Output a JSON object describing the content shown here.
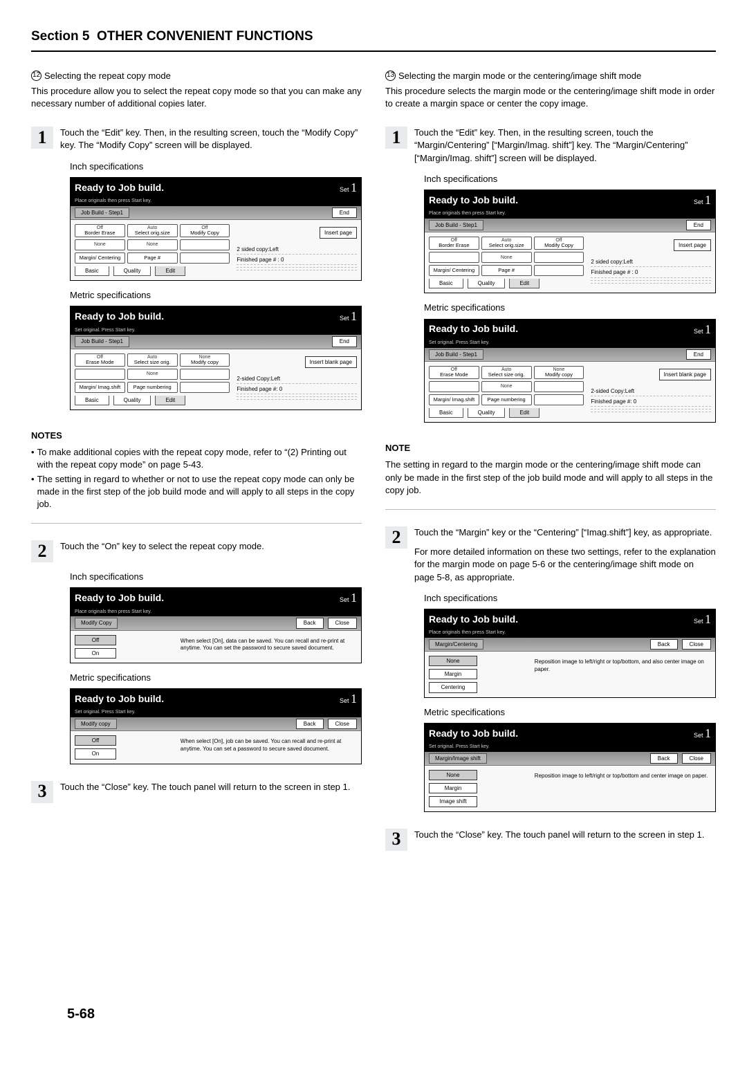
{
  "header": {
    "section_label": "Section 5",
    "title": "OTHER CONVENIENT FUNCTIONS"
  },
  "page_number": "5-68",
  "left": {
    "intro_num": "12",
    "intro_title": "Selecting the repeat copy mode",
    "intro_body": "This procedure allow you to select the repeat copy mode so that you can make any necessary number of additional copies later.",
    "step1": {
      "num": "1",
      "text": "Touch the “Edit” key. Then, in the resulting screen, touch the “Modify Copy” key. The “Modify Copy” screen will be displayed.",
      "inch_label": "Inch specifications",
      "metric_label": "Metric specifications",
      "panel_inch": {
        "title": "Ready to Job build.",
        "sub": "Place originals then press Start key.",
        "set": "Set",
        "one": "1",
        "strip": "Job Build - Step1",
        "end": "End",
        "rows": [
          [
            {
              "t": "Off",
              "s": "Border Erase"
            },
            {
              "t": "Auto",
              "s": "Select orig.size"
            },
            {
              "t": "Off",
              "s": "Modify Copy"
            }
          ],
          [
            {
              "t": "None",
              "s": ""
            },
            {
              "t": "None",
              "s": ""
            },
            {
              "t": "",
              "s": ""
            }
          ],
          [
            {
              "t": "",
              "s": "Margin/ Centering"
            },
            {
              "t": "",
              "s": "Page #"
            },
            {
              "t": "",
              "s": ""
            }
          ]
        ],
        "tabs": [
          "Basic",
          "Quality",
          "Edit"
        ],
        "side": {
          "l1": "2 sided copy:Left",
          "l2": "Finished page # : 0",
          "btn": "Insert page"
        }
      },
      "panel_metric": {
        "title": "Ready to Job build.",
        "sub": "Set original. Press Start key.",
        "set": "Set",
        "one": "1",
        "strip": "Job Build - Step1",
        "end": "End",
        "rows": [
          [
            {
              "t": "Off",
              "s": "Erase Mode"
            },
            {
              "t": "Auto",
              "s": "Select size orig."
            },
            {
              "t": "None",
              "s": "Modify copy"
            }
          ],
          [
            {
              "t": "",
              "s": ""
            },
            {
              "t": "None",
              "s": ""
            },
            {
              "t": "",
              "s": ""
            }
          ],
          [
            {
              "t": "",
              "s": "Margin/ Imag.shift"
            },
            {
              "t": "",
              "s": "Page numbering"
            },
            {
              "t": "",
              "s": ""
            }
          ]
        ],
        "tabs": [
          "Basic",
          "Quality",
          "Edit"
        ],
        "side": {
          "l1": "2-sided Copy:Left",
          "l2": "Finished page #: 0",
          "btn": "Insert blank page"
        }
      }
    },
    "notes_head": "NOTES",
    "notes": [
      "To make additional copies with the repeat copy mode, refer to “(2) Printing out with the repeat copy mode” on page 5-43.",
      "The setting in regard to whether or not to use the repeat copy mode can only be made in the first step of the job build mode and will apply to all steps in the copy job."
    ],
    "step2": {
      "num": "2",
      "text": "Touch the “On” key to select the repeat copy mode.",
      "inch_label": "Inch specifications",
      "metric_label": "Metric specifications",
      "panel_inch": {
        "title": "Ready to Job build.",
        "sub": "Place originals then press Start key.",
        "set": "Set",
        "one": "1",
        "strip": "Modify Copy",
        "back": "Back",
        "close": "Close",
        "opts": [
          "Off",
          "On"
        ],
        "desc": "When select [On], data can be saved. You can recall and re-print at anytime. You can set the password to secure saved document."
      },
      "panel_metric": {
        "title": "Ready to Job build.",
        "sub": "Set original. Press Start key.",
        "set": "Set",
        "one": "1",
        "strip": "Modify copy",
        "back": "Back",
        "close": "Close",
        "opts": [
          "Off",
          "On"
        ],
        "desc": "When select [On], job can be saved. You can recall and re-print at anytime. You can set a password to secure saved document."
      }
    },
    "step3": {
      "num": "3",
      "text": "Touch the “Close” key. The touch panel will return to the screen in step 1."
    }
  },
  "right": {
    "intro_num": "13",
    "intro_title": "Selecting the margin mode or the centering/image shift mode",
    "intro_body": "This procedure selects the margin mode or the centering/image shift mode in order to create a margin space or center the copy image.",
    "step1": {
      "num": "1",
      "text": "Touch the “Edit” key. Then, in the resulting screen, touch the “Margin/Centering” [“Margin/Imag. shift”] key. The “Margin/Centering” [“Margin/Imag. shift”] screen will be displayed.",
      "inch_label": "Inch specifications",
      "metric_label": "Metric specifications",
      "panel_inch": {
        "title": "Ready to Job build.",
        "sub": "Place originals then press Start key.",
        "set": "Set",
        "one": "1",
        "strip": "Job Build - Step1",
        "end": "End",
        "rows": [
          [
            {
              "t": "Off",
              "s": "Border Erase"
            },
            {
              "t": "Auto",
              "s": "Select orig.size"
            },
            {
              "t": "Off",
              "s": "Modify Copy"
            }
          ],
          [
            {
              "t": "",
              "s": ""
            },
            {
              "t": "None",
              "s": ""
            },
            {
              "t": "",
              "s": ""
            }
          ],
          [
            {
              "t": "",
              "s": "Margin/ Centering"
            },
            {
              "t": "",
              "s": "Page #"
            },
            {
              "t": "",
              "s": ""
            }
          ]
        ],
        "tabs": [
          "Basic",
          "Quality",
          "Edit"
        ],
        "side": {
          "l1": "2 sided copy:Left",
          "l2": "Finished page # : 0",
          "btn": "Insert page"
        }
      },
      "panel_metric": {
        "title": "Ready to Job build.",
        "sub": "Set original. Press Start key.",
        "set": "Set",
        "one": "1",
        "strip": "Job Build - Step1",
        "end": "End",
        "rows": [
          [
            {
              "t": "Off",
              "s": "Erase Mode"
            },
            {
              "t": "Auto",
              "s": "Select size orig."
            },
            {
              "t": "None",
              "s": "Modify copy"
            }
          ],
          [
            {
              "t": "",
              "s": ""
            },
            {
              "t": "None",
              "s": ""
            },
            {
              "t": "",
              "s": ""
            }
          ],
          [
            {
              "t": "",
              "s": "Margin/ Imag.shift"
            },
            {
              "t": "",
              "s": "Page numbering"
            },
            {
              "t": "",
              "s": ""
            }
          ]
        ],
        "tabs": [
          "Basic",
          "Quality",
          "Edit"
        ],
        "side": {
          "l1": "2-sided Copy:Left",
          "l2": "Finished page #: 0",
          "btn": "Insert blank page"
        }
      }
    },
    "note_head": "NOTE",
    "note_body": "The setting in regard to the margin mode or the centering/image shift mode can only be made in the first step of the job build mode and will apply to all steps in the copy job.",
    "step2": {
      "num": "2",
      "text": "Touch the “Margin” key or the “Centering” [“Imag.shift”] key, as appropriate.",
      "followup": "For more detailed information on these two settings, refer to the explanation for the margin mode on page 5-6 or the centering/image shift mode on page 5-8, as appropriate.",
      "inch_label": "Inch specifications",
      "metric_label": "Metric specifications",
      "panel_inch": {
        "title": "Ready to Job build.",
        "sub": "Place originals then press Start key.",
        "set": "Set",
        "one": "1",
        "strip": "Margin/Centering",
        "back": "Back",
        "close": "Close",
        "opts": [
          "None",
          "Margin",
          "Centering"
        ],
        "desc": "Reposition image to left/right or top/bottom, and also center image on paper."
      },
      "panel_metric": {
        "title": "Ready to Job build.",
        "sub": "Set original. Press Start key.",
        "set": "Set",
        "one": "1",
        "strip": "Margin/Image shift",
        "back": "Back",
        "close": "Close",
        "opts": [
          "None",
          "Margin",
          "Image shift"
        ],
        "desc": "Reposition image to left/right or top/bottom and center image on paper."
      }
    },
    "step3": {
      "num": "3",
      "text": "Touch the “Close” key. The touch panel will return to the screen in step 1."
    }
  }
}
